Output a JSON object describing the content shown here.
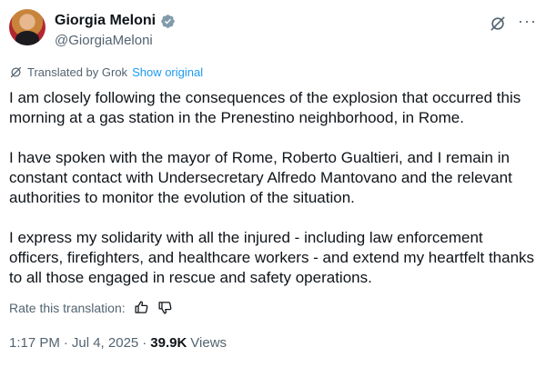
{
  "author": {
    "display_name": "Giorgia Meloni",
    "handle": "@GiorgiaMeloni",
    "verified": true
  },
  "translation": {
    "label": "Translated by Grok",
    "show_original": "Show original"
  },
  "tweet": {
    "paragraphs": [
      "I am closely following the consequences of the explosion that occurred this morning at a gas station in the Prenestino neighborhood, in Rome.",
      "I have spoken with the mayor of Rome, Roberto Gualtieri, and I remain in constant contact with Undersecretary Alfredo Mantovano and the relevant authorities to monitor the evolution of the situation.",
      "I express my solidarity with all the injured - including law enforcement officers, firefighters, and healthcare workers - and extend my heartfelt thanks to all those engaged in rescue and safety operations."
    ]
  },
  "rating": {
    "label": "Rate this translation:"
  },
  "meta": {
    "time": "1:17 PM",
    "separator": "·",
    "date": "Jul 4, 2025",
    "views_count": "39.9K",
    "views_label": "Views"
  },
  "colors": {
    "text": "#0f1419",
    "secondary": "#536471",
    "link": "#1d9bf0",
    "verified_badge": "#829aab"
  }
}
